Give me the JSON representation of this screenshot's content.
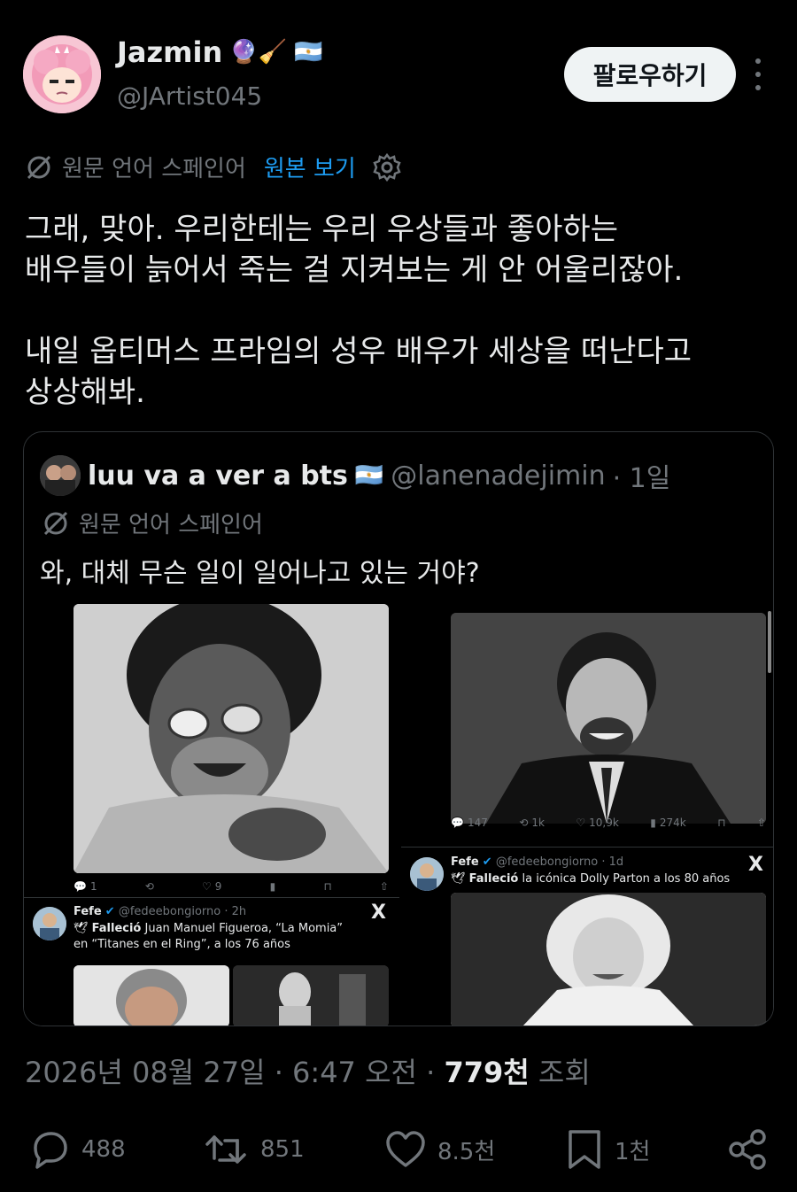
{
  "author": {
    "name": "Jazmin",
    "emojis": "🔮🧹",
    "flag": "🇦🇷",
    "handle": "@JArtist045"
  },
  "follow_button": "팔로우하기",
  "translation": {
    "label": "원문 언어 스페인어",
    "link": "원본 보기"
  },
  "tweet_text": {
    "line1": "그래, 맞아. 우리한테는 우리 우상들과 좋아하는",
    "line2": "배우들이 늙어서 죽는 걸 지켜보는 게 안 어울리잖아.",
    "line3": "내일 옵티머스 프라임의 성우 배우가 세상을 떠난다고",
    "line4": "상상해봐."
  },
  "quoted": {
    "name": "luu va a ver a bts",
    "flag": "🇦🇷",
    "handle": "@lanenadejimin",
    "time": "· 1일",
    "translation_label": "원문 언어 스페인어",
    "text": "와, 대체 무슨 일이 일어나고 있는 거야?",
    "left_photo_actions": {
      "replies": "1",
      "likes": "9"
    },
    "right_photo_actions": {
      "replies": "147",
      "retweets": "1k",
      "likes": "10,9k",
      "views": "274k"
    },
    "mini_tweet_left": {
      "name": "Fefe",
      "handle": "@fedeebongiorno · 2h",
      "bold": "Falleció",
      "text": " Juan Manuel Figueroa, “La Momia” en “Titanes en el Ring”, a los 76 años"
    },
    "mini_tweet_right": {
      "name": "Fefe",
      "handle": "@fedeebongiorno · 1d",
      "bold": "Falleció",
      "text": " la icónica Dolly Parton a los 80 años"
    },
    "x_label": "X"
  },
  "meta": {
    "datetime": "2026년 08월 27일 · 6:47 오전 · ",
    "views_count": "779천",
    "views_label": " 조회"
  },
  "stats": {
    "replies": "488",
    "retweets": "851",
    "likes": "8.5천",
    "bookmarks": "1천"
  },
  "colors": {
    "background": "#000000",
    "text": "#e7e9ea",
    "muted": "#71767b",
    "accent": "#1d9bf0"
  }
}
